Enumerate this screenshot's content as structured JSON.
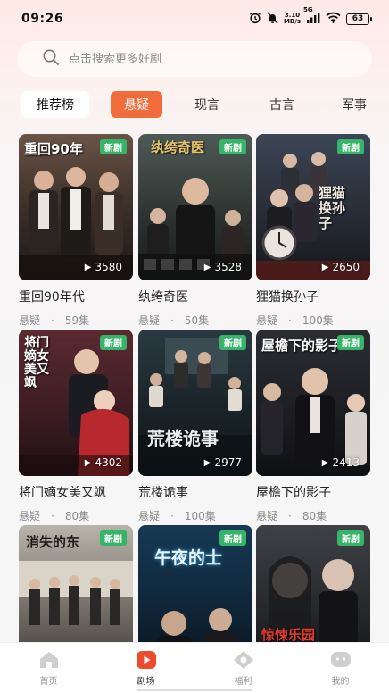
{
  "status_bar": {
    "time": "09:26",
    "net_speed_value": "3.10",
    "net_speed_unit": "MB/s",
    "signal_label": "5G",
    "battery": "63"
  },
  "search": {
    "placeholder": "点击搜索更多好剧"
  },
  "tabs": [
    {
      "label": "推荐榜"
    },
    {
      "label": "悬疑"
    },
    {
      "label": "现言"
    },
    {
      "label": "古言"
    },
    {
      "label": "军事"
    }
  ],
  "active_tab": "悬疑",
  "accent_color": "#f06c3a",
  "badge_color": "#38b36a",
  "cards": [
    {
      "title": "重回90年代",
      "genre": "悬疑",
      "episodes": "59集",
      "plays": "3580",
      "badge": "新剧",
      "poster_text": "重回90年"
    },
    {
      "title": "纨绔奇医",
      "genre": "悬疑",
      "episodes": "50集",
      "plays": "3528",
      "badge": "新剧",
      "poster_text": "纨绔奇医"
    },
    {
      "title": "狸猫换孙子",
      "genre": "悬疑",
      "episodes": "100集",
      "plays": "2650",
      "badge": "新剧",
      "poster_text": "狸猫换孙子"
    },
    {
      "title": "将门嫡女美又飒",
      "genre": "悬疑",
      "episodes": "80集",
      "plays": "4302",
      "badge": "新剧",
      "poster_text": "将门嫡女美又飒"
    },
    {
      "title": "荒楼诡事",
      "genre": "悬疑",
      "episodes": "100集",
      "plays": "2977",
      "badge": "新剧",
      "poster_text": "荒楼诡事"
    },
    {
      "title": "屋檐下的影子",
      "genre": "悬疑",
      "episodes": "80集",
      "plays": "2413",
      "badge": "新剧",
      "poster_text": "屋檐下的影子"
    },
    {
      "title": "",
      "genre": "",
      "episodes": "",
      "plays": "",
      "badge": "新剧",
      "poster_text": "消失的东"
    },
    {
      "title": "",
      "genre": "",
      "episodes": "",
      "plays": "",
      "badge": "新剧",
      "poster_text": "午夜的士"
    },
    {
      "title": "",
      "genre": "",
      "episodes": "",
      "plays": "",
      "badge": "新剧",
      "poster_text": "惊悚乐园"
    }
  ],
  "bottom_nav": [
    {
      "label": "首页",
      "icon": "home-icon"
    },
    {
      "label": "剧场",
      "icon": "theater-icon"
    },
    {
      "label": "福利",
      "icon": "gift-icon"
    },
    {
      "label": "我的",
      "icon": "profile-icon"
    }
  ],
  "active_nav": "剧场"
}
